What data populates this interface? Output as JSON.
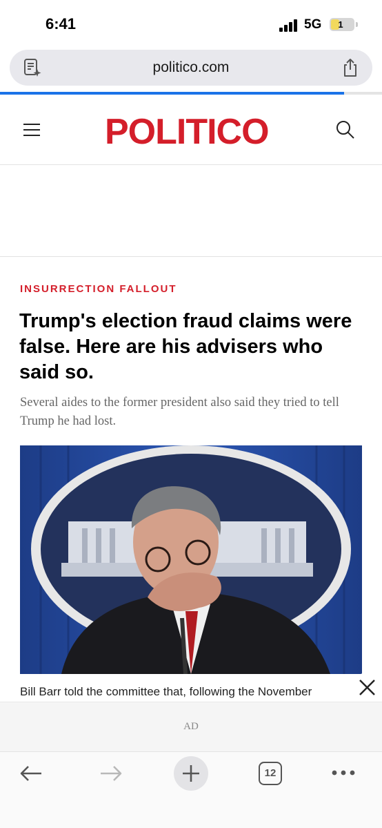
{
  "status_bar": {
    "time": "6:41",
    "network": "5G",
    "battery_level": "1"
  },
  "browser": {
    "url": "politico.com",
    "reader_icon": "reader-mode-icon",
    "share_icon": "share-icon",
    "load_progress": 0.9,
    "accent_color": "#1a73e8"
  },
  "site": {
    "logo": "POLITICO",
    "brand_color": "#d41e2a",
    "menu_icon": "hamburger-menu-icon",
    "search_icon": "search-icon"
  },
  "article": {
    "kicker": "INSURRECTION FALLOUT",
    "headline": "Trump's election fraud claims were false. Here are his advisers who said so.",
    "dek": "Several aides to the former president also said they tried to tell Trump he had lost.",
    "caption": "Bill Barr told the committee that, following the November"
  },
  "ad": {
    "label": "AD",
    "close_icon": "close-icon"
  },
  "toolbar": {
    "back_icon": "back-arrow-icon",
    "forward_icon": "forward-arrow-icon",
    "new_tab_icon": "plus-icon",
    "tab_count": "12",
    "more_icon": "more-dots-icon"
  }
}
